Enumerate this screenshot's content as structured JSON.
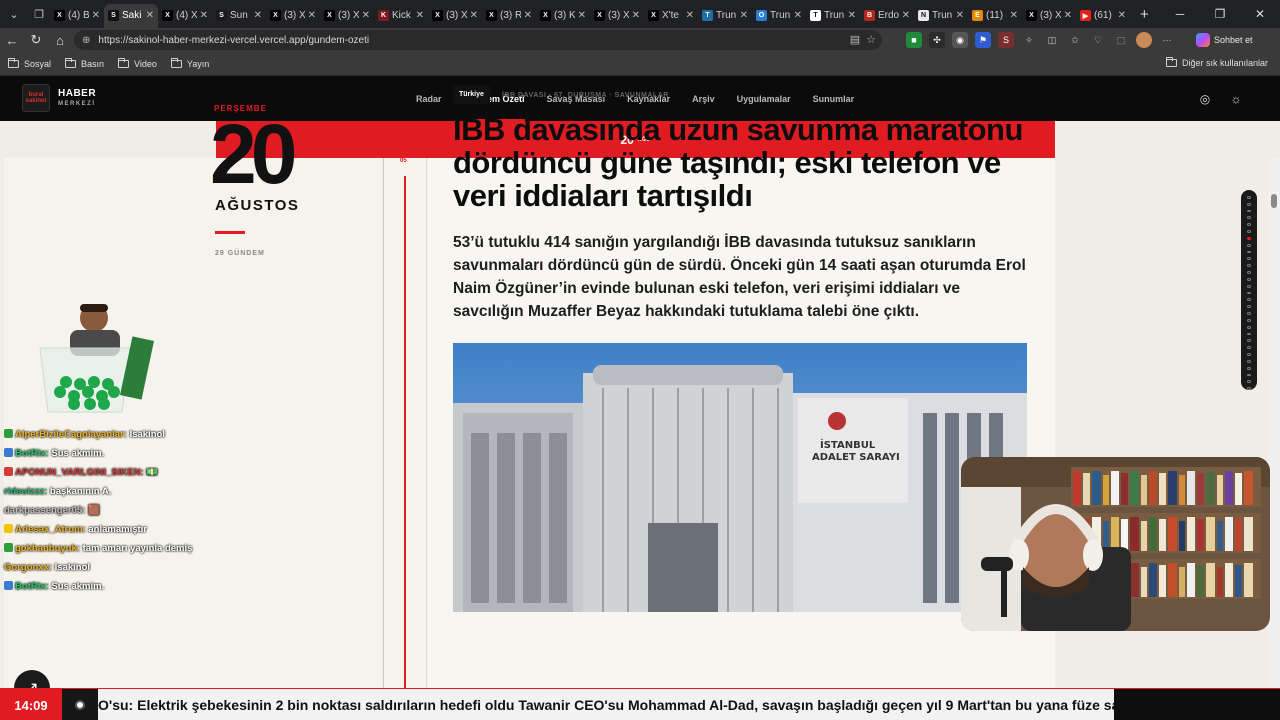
{
  "browser": {
    "tabs": [
      {
        "title": "(4) B",
        "color": "#000000",
        "glyph": "X"
      },
      {
        "title": "Saki",
        "color": "#111111",
        "glyph": "S",
        "active": true
      },
      {
        "title": "(4) X",
        "color": "#000000",
        "glyph": "X"
      },
      {
        "title": "Sun",
        "color": "#1a1a1a",
        "glyph": "S"
      },
      {
        "title": "(3) X",
        "color": "#000000",
        "glyph": "X"
      },
      {
        "title": "(3) X",
        "color": "#000000",
        "glyph": "X"
      },
      {
        "title": "Kick",
        "color": "#7a1a1a",
        "glyph": "K"
      },
      {
        "title": "(3) X",
        "color": "#000000",
        "glyph": "X"
      },
      {
        "title": "(3) R",
        "color": "#000000",
        "glyph": "X"
      },
      {
        "title": "(3) K",
        "color": "#000000",
        "glyph": "X"
      },
      {
        "title": "(3) X",
        "color": "#000000",
        "glyph": "X"
      },
      {
        "title": "X'te",
        "color": "#000000",
        "glyph": "X"
      },
      {
        "title": "Trun",
        "color": "#1d6fa5",
        "glyph": "T"
      },
      {
        "title": "Trun",
        "color": "#2a7fd4",
        "glyph": "O"
      },
      {
        "title": "Trun",
        "color": "#ffffff",
        "glyph": "T"
      },
      {
        "title": "Erdo",
        "color": "#b3261e",
        "glyph": "B"
      },
      {
        "title": "Trun",
        "color": "#e8e8e8",
        "glyph": "N"
      },
      {
        "title": "(11)",
        "color": "#e08a00",
        "glyph": "E"
      },
      {
        "title": "(3) X",
        "color": "#000000",
        "glyph": "X"
      },
      {
        "title": "(61)",
        "color": "#e62117",
        "glyph": "▶"
      }
    ],
    "url": "https://sakinol-haber-merkezi-vercel.vercel.app/gundem-ozeti",
    "copilot_label": "Sohbet et",
    "bookmarks": [
      "Sosyal",
      "Basın",
      "Video",
      "Yayın"
    ],
    "bookmarks_other": "Diğer sık kullanılanlar"
  },
  "site": {
    "logo_mark": "bural sakinol",
    "logo_line1": "HABER",
    "logo_line2": "MERKEZİ",
    "nav": [
      "Radar",
      "Gündem Özeti",
      "Savaş Masası",
      "Kaynaklar",
      "Arşiv",
      "Uygulamalar",
      "Sunumlar"
    ],
    "active_nav": "Gündem Özeti",
    "datebar_day": "20",
    "datebar_month": "AĞU",
    "weekday": "PERŞEMBE",
    "day_number": "20",
    "month_name": "AĞUSTOS",
    "day_count": "29 GÜNDEM",
    "timeline_number": "05",
    "article": {
      "category": "Türkiye",
      "tags": "İBB DAVASI · 67. DURUŞMA · SAVUNMALAR",
      "headline": "İBB davasında uzun savunma maratonu dördüncü güne taşındı; eski telefon ve veri iddiaları tartışıldı",
      "lede": "53’ü tutuklu 414 sanığın yargılandığı İBB davasında tutuksuz sanıkların savunmaları dördüncü gün de sürdü. Önceki gün 14 saati aşan oturumda Erol Naim Özgüner’in evinde bulunan eski telefon, veri erişimi iddiaları ve savcılığın Muzaffer Beyaz hakkındaki tutuklama talebi öne çıktı.",
      "photo_sign1": "İSTANBUL",
      "photo_sign2": "ADALET SARAYI"
    },
    "accent_color": "#e11b22"
  },
  "chat": [
    {
      "user": "AlperBizileCagolayanlar:",
      "msg": "Isakinol",
      "color": "#f0b428",
      "badge": "#2e9e3c"
    },
    {
      "user": "BotRix:",
      "msg": "Sus akmim.",
      "color": "#29c46b",
      "badge": "#3a7bd5"
    },
    {
      "user": "APONUN_VARLGINI_SIKEN:",
      "msg": "💵",
      "color": "#d63a3a",
      "badge": "#d63a3a"
    },
    {
      "user": "ridsuizzz:",
      "msg": "başkanının A.",
      "color": "#2bb673",
      "badge": ""
    },
    {
      "user": "darkpassenger05:",
      "msg": "🟫",
      "color": "#c0c0c0",
      "badge": ""
    },
    {
      "user": "Arlesax_Atrum:",
      "msg": "anlamamıştır",
      "color": "#f0b428",
      "badge": "#f2c300"
    },
    {
      "user": "gokhanbuyuk:",
      "msg": "tam amarı yayınla demiş",
      "color": "#f0b428",
      "badge": "#2e9e3c"
    },
    {
      "user": "Gorgonxx:",
      "msg": "Isakinol",
      "color": "#f0b428",
      "badge": ""
    },
    {
      "user": "BotRix:",
      "msg": "Sus akmim.",
      "color": "#29c46b",
      "badge": "#3a7bd5"
    }
  ],
  "ticker": {
    "time": "14:09",
    "text": "O'su: Elektrik şebekesinin 2 bin noktası saldırıların hedefi oldu Tawanir CEO'su Mohammad Al-Dad, savaşın başladığı geçen yıl 9 Mart'tan bu yana füze saldır"
  }
}
